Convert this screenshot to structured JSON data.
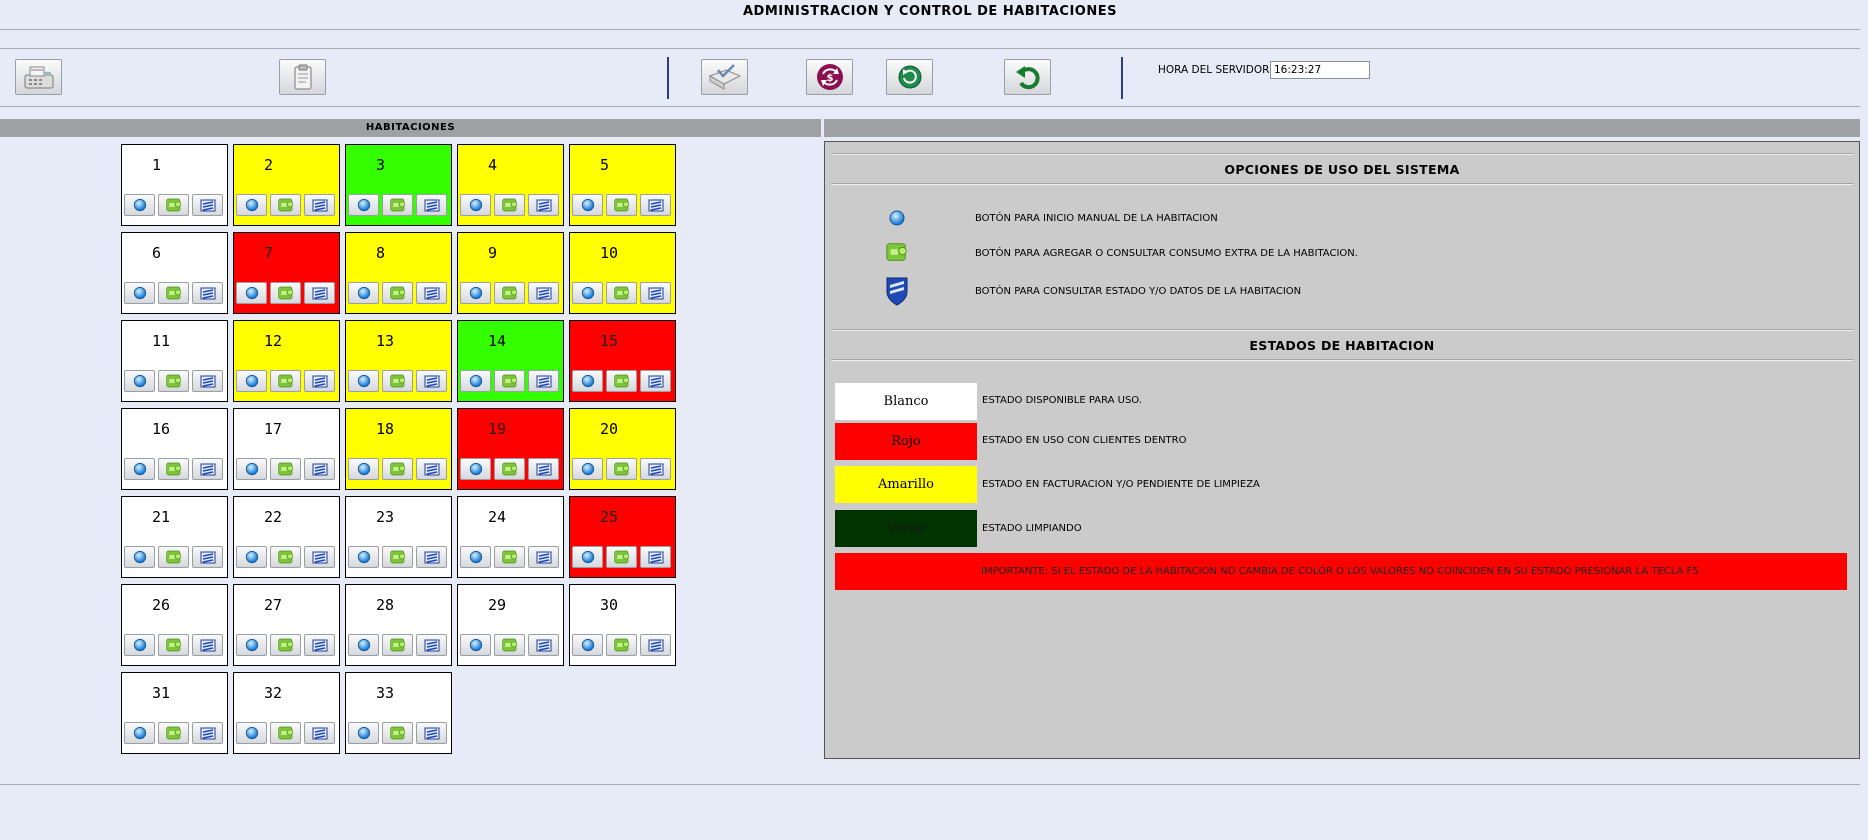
{
  "header": {
    "title": "ADMINISTRACION Y CONTROL DE HABITACIONES"
  },
  "toolbar": {
    "buttons": [
      {
        "icon": "cash-register-icon"
      },
      {
        "icon": "clipboard-icon"
      },
      {
        "icon": "checkmark-page-icon"
      },
      {
        "icon": "currency-exchange-icon"
      },
      {
        "icon": "refresh-icon"
      },
      {
        "icon": "undo-icon"
      }
    ],
    "server_time_label": "HORA DEL SERVIDOR",
    "server_time_value": "16:23:27"
  },
  "rooms_panel": {
    "title": "HABITACIONES",
    "rooms": [
      {
        "number": "1",
        "state": "white"
      },
      {
        "number": "2",
        "state": "yellow"
      },
      {
        "number": "3",
        "state": "green"
      },
      {
        "number": "4",
        "state": "yellow"
      },
      {
        "number": "5",
        "state": "yellow"
      },
      {
        "number": "6",
        "state": "white"
      },
      {
        "number": "7",
        "state": "red"
      },
      {
        "number": "8",
        "state": "yellow"
      },
      {
        "number": "9",
        "state": "yellow"
      },
      {
        "number": "10",
        "state": "yellow"
      },
      {
        "number": "11",
        "state": "white"
      },
      {
        "number": "12",
        "state": "yellow"
      },
      {
        "number": "13",
        "state": "yellow"
      },
      {
        "number": "14",
        "state": "green"
      },
      {
        "number": "15",
        "state": "red"
      },
      {
        "number": "16",
        "state": "white"
      },
      {
        "number": "17",
        "state": "white"
      },
      {
        "number": "18",
        "state": "yellow"
      },
      {
        "number": "19",
        "state": "red"
      },
      {
        "number": "20",
        "state": "yellow"
      },
      {
        "number": "21",
        "state": "white"
      },
      {
        "number": "22",
        "state": "white"
      },
      {
        "number": "23",
        "state": "white"
      },
      {
        "number": "24",
        "state": "white"
      },
      {
        "number": "25",
        "state": "red"
      },
      {
        "number": "26",
        "state": "white"
      },
      {
        "number": "27",
        "state": "white"
      },
      {
        "number": "28",
        "state": "white"
      },
      {
        "number": "29",
        "state": "white"
      },
      {
        "number": "30",
        "state": "white"
      },
      {
        "number": "31",
        "state": "white"
      },
      {
        "number": "32",
        "state": "white"
      },
      {
        "number": "33",
        "state": "white"
      }
    ],
    "room_buttons": [
      "start-icon",
      "extra-consumption-icon",
      "room-details-icon"
    ]
  },
  "info_panel": {
    "options_title": "OPCIONES DE USO DEL SISTEMA",
    "options": [
      {
        "icon": "start-icon",
        "text": "BOTÓN PARA INICIO MANUAL DE LA HABITACION"
      },
      {
        "icon": "extra-consumption-icon",
        "text": "BOTÓN PARA AGREGAR O CONSULTAR CONSUMO EXTRA DE LA HABITACION."
      },
      {
        "icon": "shield-icon",
        "text": "BOTÓN PARA CONSULTAR ESTADO Y/O DATOS DE LA HABITACION"
      }
    ],
    "states_title": "ESTADOS DE HABITACION",
    "states": [
      {
        "label": "Blanco",
        "color": "#ffffff",
        "text_color": "#000000",
        "text": "ESTADO DISPONIBLE PARA USO."
      },
      {
        "label": "Rojo",
        "color": "#ff0000",
        "text_color": "#000000",
        "text": "ESTADO EN USO CON CLIENTES DENTRO"
      },
      {
        "label": "Amarillo",
        "color": "#ffff00",
        "text_color": "#000000",
        "text": "ESTADO EN FACTURACION Y/O PENDIENTE DE LIMPIEZA"
      },
      {
        "label": "Verde",
        "color": "#003300",
        "text_color": "#1a1a1a",
        "text": "ESTADO LIMPIANDO"
      }
    ],
    "important_note": "IMPORTANTE: SI EL ESTADO DE LA HABITACION NO CAMBIA DE COLOR O LOS VALORES NO COINCIDEN EN SU ESTADO PRESIONAR LA TECLA F5"
  },
  "colors": {
    "white": "#ffffff",
    "yellow": "#ffff00",
    "green": "#33ff00",
    "red": "#ff0000",
    "page_bg": "#e6ebf7",
    "panel_bg": "#cbcbcb",
    "header_bg": "#9ea0a3",
    "separator": "#2b3f80"
  }
}
